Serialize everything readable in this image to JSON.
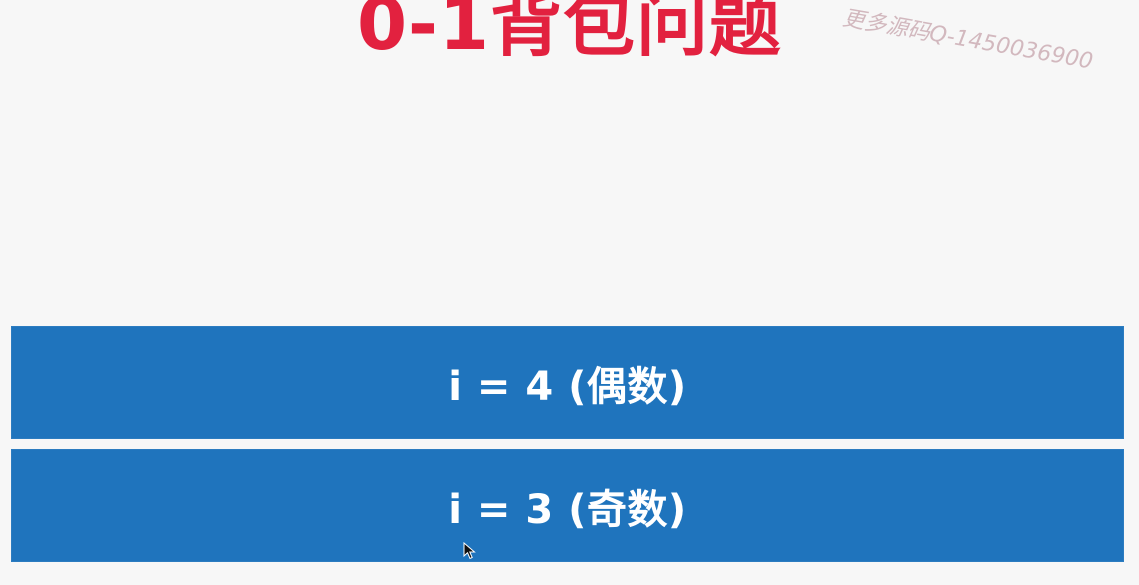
{
  "slide": {
    "title": "0-1背包问题",
    "watermark": "更多源码Q-1450036900"
  },
  "bars": {
    "even_label": "i = 4 (偶数)",
    "odd_label": "i = 3 (奇数)"
  },
  "colors": {
    "title": "#e2213f",
    "bar": "#1f74bd",
    "background": "#f7f7f7"
  },
  "icons": {
    "pointer": "mouse-pointer-icon"
  }
}
